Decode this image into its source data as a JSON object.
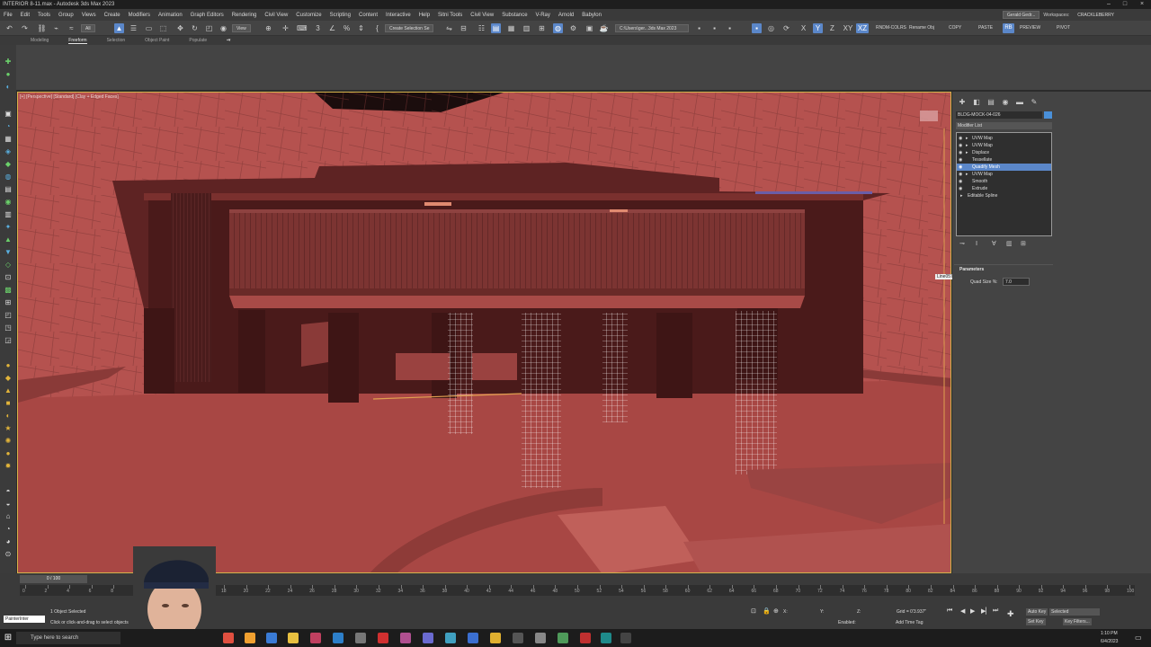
{
  "app": {
    "title": "INTERIOR 8-11.max - Autodesk 3ds Max 2023"
  },
  "menu": {
    "items": [
      "File",
      "Edit",
      "Tools",
      "Group",
      "Views",
      "Create",
      "Modifiers",
      "Animation",
      "Graph Editors",
      "Rendering",
      "Civil View",
      "Customize",
      "Scripting",
      "Content",
      "Interactive",
      "Help",
      "Sitni Tools",
      "Civil View",
      "Substance",
      "V-Ray",
      "Arnold",
      "Babylon"
    ],
    "user": "Gerald Gedr...",
    "workspaces_label": "Workspaces:",
    "workspace": "CRACKLEBERRY"
  },
  "toolbar": {
    "filter": "All",
    "view": "View",
    "selection_set": "Create Selection Se",
    "path": "C:\\Users\\ger...3ds Max 2023",
    "axis_x": "X",
    "axis_y": "Y",
    "axis_z": "Z",
    "axis_xy": "XY",
    "axis_xz": "XZ",
    "rb": "RB",
    "script_buttons": [
      "RNDM-COLRS",
      "Rename Obj",
      "COPY",
      "PASTE",
      "PREVIEW",
      "PIVOT"
    ]
  },
  "ribbon": {
    "tabs": [
      "Modeling",
      "Freeform",
      "Selection",
      "Object Paint",
      "Populate"
    ],
    "active_tab": "Freeform"
  },
  "viewport": {
    "label": "[+] [Perspective] [Standard] [Clay + Edged Faces]",
    "gizmo_label": "Line057",
    "colors": {
      "clay": "#b5524f",
      "clay_dark": "#8a3a38",
      "structure": "#5e2323",
      "wire": "#ffffff",
      "frame": "#d4b24a"
    }
  },
  "command_panel": {
    "object_name": "BLDG-MOCK-04-026",
    "object_color": "#4a90d9",
    "modifier_list": "Modifier List",
    "stack": [
      {
        "name": "UVW Map",
        "selected": false
      },
      {
        "name": "UVW Map",
        "selected": false
      },
      {
        "name": "Displace",
        "selected": false
      },
      {
        "name": "Tessellate",
        "selected": false
      },
      {
        "name": "Quadify Mesh",
        "selected": true
      },
      {
        "name": "UVW Map",
        "selected": false
      },
      {
        "name": "Smooth",
        "selected": false
      },
      {
        "name": "Extrude",
        "selected": false
      },
      {
        "name": "Editable Spline",
        "selected": false
      }
    ],
    "rollout": "Parameters",
    "quad_size_label": "Quad Size %:",
    "quad_size_value": "7.0"
  },
  "timeline": {
    "frame": "0 / 100",
    "ticks": [
      "0",
      "2",
      "4",
      "6",
      "8",
      "10",
      "12",
      "14",
      "16",
      "18",
      "20",
      "22",
      "24",
      "26",
      "28",
      "30",
      "32",
      "34",
      "36",
      "38",
      "40",
      "42",
      "44",
      "46",
      "48",
      "50",
      "52",
      "54",
      "56",
      "58",
      "60",
      "62",
      "64",
      "66",
      "68",
      "70",
      "72",
      "74",
      "76",
      "78",
      "80",
      "82",
      "84",
      "86",
      "88",
      "90",
      "92",
      "94",
      "96",
      "98",
      "100"
    ]
  },
  "status": {
    "maxscript": "PainterInter",
    "selection": "1 Object Selected",
    "prompt": "Click or click-and-drag to select objects",
    "x_label": "X:",
    "y_label": "Y:",
    "z_label": "Z:",
    "grid": "Grid = 0'3.937\"",
    "enabled": "Enabled:",
    "add_time_tag": "Add Time Tag",
    "auto_key": "Auto Key",
    "set_key": "Set Key",
    "selected": "Selected",
    "key_filters": "Key Filters..."
  },
  "taskbar": {
    "search_placeholder": "Type here to search",
    "time": "1:10 PM",
    "date": "6/4/2023"
  }
}
